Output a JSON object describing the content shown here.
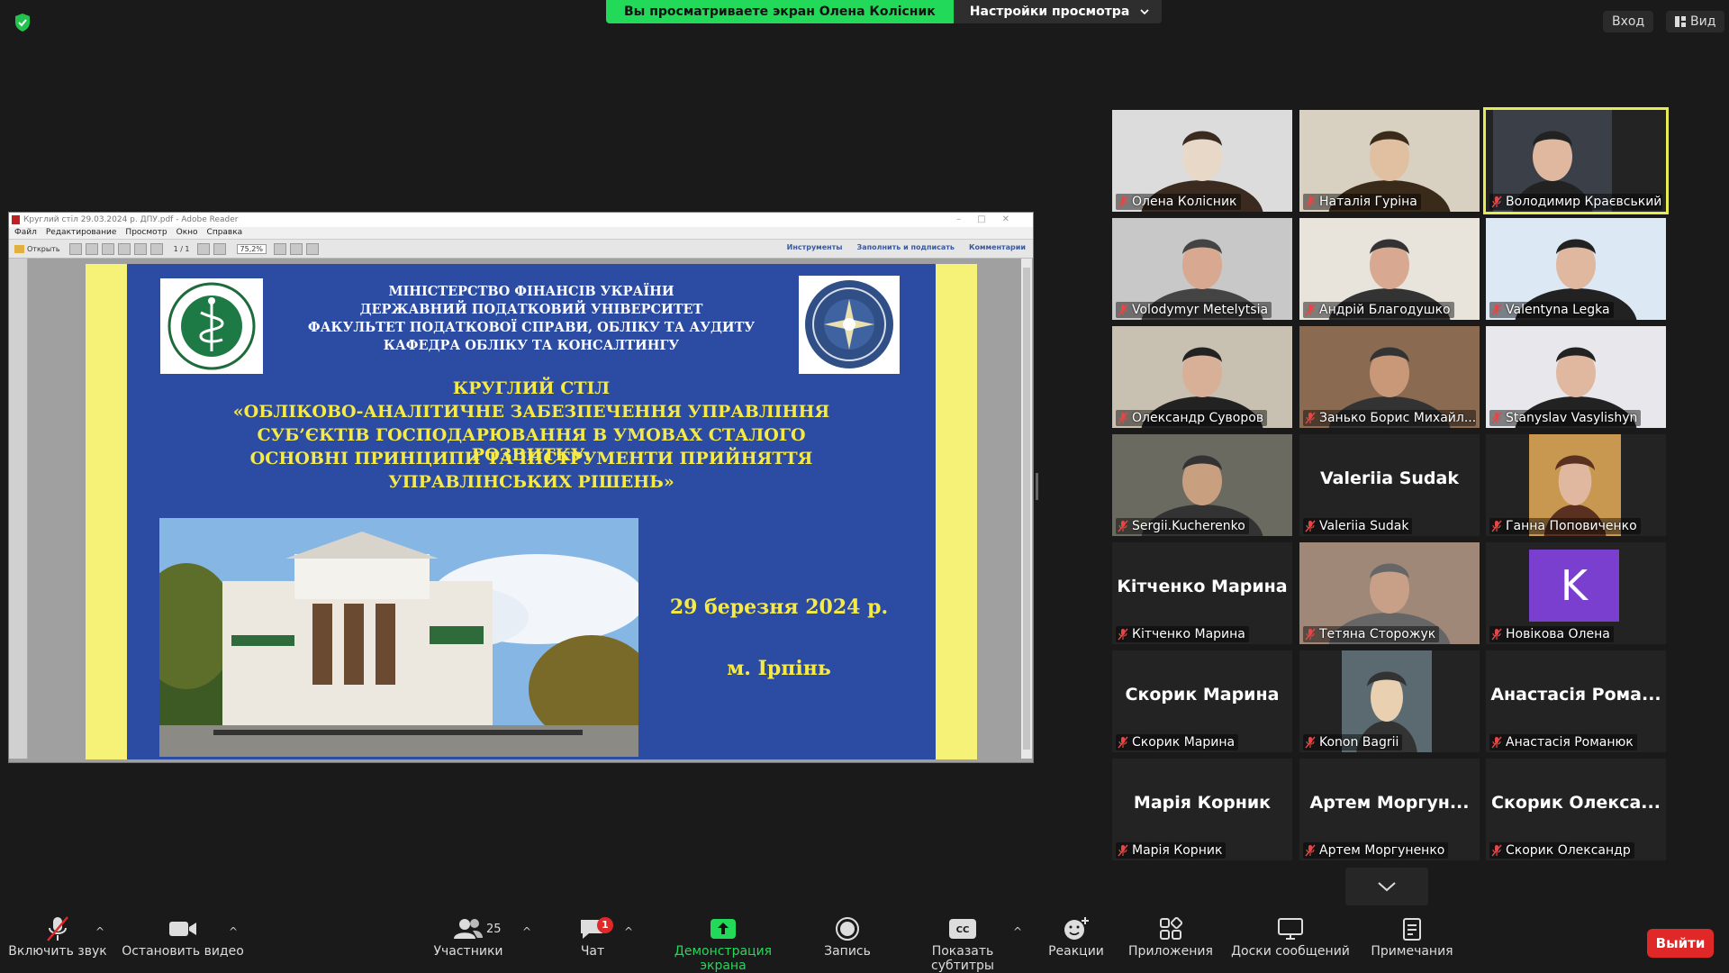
{
  "banner": {
    "sharing_text": "Вы просматриваете экран Олена Колісник",
    "view_settings": "Настройки просмотра"
  },
  "top_right": {
    "login": "Вход",
    "view": "Вид"
  },
  "reader": {
    "title": "Круглий стіл 29.03.2024 р. ДПУ.pdf - Adobe Reader",
    "menu": [
      "Файл",
      "Редактирование",
      "Просмотр",
      "Окно",
      "Справка"
    ],
    "open_label": "Открыть",
    "page_label": "1 / 1",
    "zoom": "75,2%",
    "tools": "Инструменты",
    "fill_sign": "Заполнить и подписать",
    "comments": "Комментарии"
  },
  "slide": {
    "org_lines": [
      "МІНІСТЕРСТВО ФІНАНСІВ УКРАЇНИ",
      "ДЕРЖАВНИЙ ПОДАТКОВИЙ УНІВЕРСИТЕТ",
      "ФАКУЛЬТЕТ ПОДАТКОВОЇ СПРАВИ, ОБЛІКУ ТА АУДИТУ",
      "КАФЕДРА ОБЛІКУ ТА КОНСАЛТИНГУ"
    ],
    "title_lines": [
      "КРУГЛИЙ СТІЛ",
      "«ОБЛІКОВО-АНАЛІТИЧНЕ ЗАБЕЗПЕЧЕННЯ УПРАВЛІННЯ",
      "СУБ’ЄКТІВ ГОСПОДАРЮВАННЯ В УМОВАХ СТАЛОГО РОЗВИТКУ:",
      "ОСНОВНІ ПРИНЦИПИ ТА ІНСТРУМЕНТИ ПРИЙНЯТТЯ",
      "УПРАВЛІНСЬКИХ РІШЕНЬ»"
    ],
    "date": "29 березня 2024 р.",
    "city": "м. Ірпінь"
  },
  "participants": [
    {
      "name": "Олена Колісник",
      "big": ""
    },
    {
      "name": "Наталія Гуріна",
      "big": ""
    },
    {
      "name": "Володимир Краєвський",
      "big": ""
    },
    {
      "name": "Volodymyr Metelytsia",
      "big": ""
    },
    {
      "name": "Андрій Благодушко",
      "big": ""
    },
    {
      "name": "Valentyna Legka",
      "big": ""
    },
    {
      "name": "Олександр Суворов",
      "big": ""
    },
    {
      "name": "Занько Борис Михайл...",
      "big": ""
    },
    {
      "name": "Stanyslav Vasylishyn",
      "big": ""
    },
    {
      "name": "Sergii.Kucherenko",
      "big": ""
    },
    {
      "name": "Valeriia Sudak",
      "big": "Valeriia Sudak"
    },
    {
      "name": "Ганна Поповиченко",
      "big": ""
    },
    {
      "name": "Кітченко Марина",
      "big": "Кітченко Марина"
    },
    {
      "name": "Тетяна Сторожук",
      "big": ""
    },
    {
      "name": "Новікова Олена",
      "big": ""
    },
    {
      "name": "Скорик Марина",
      "big": "Скорик Марина"
    },
    {
      "name": "Konon Bagrii",
      "big": ""
    },
    {
      "name": "Анастасія Романюк",
      "big": "Анастасія Рома..."
    },
    {
      "name": "Марія Корник",
      "big": "Марія Корник"
    },
    {
      "name": "Артем Моргуненко",
      "big": "Артем Моргун..."
    },
    {
      "name": "Скорик Олександр",
      "big": "Скорик Олекса..."
    }
  ],
  "avatar_letter": "K",
  "toolbar": {
    "unmute": "Включить звук",
    "stop_video": "Остановить видео",
    "participants": "Участники",
    "participants_count": "25",
    "chat": "Чат",
    "chat_badge": "1",
    "share": "Демонстрация экрана",
    "record": "Запись",
    "captions": "Показать субтитры",
    "reactions": "Реакции",
    "apps": "Приложения",
    "whiteboards": "Доски сообщений",
    "notes": "Примечания",
    "leave": "Выйти"
  },
  "colors": {
    "share_green": "#23d959",
    "active_speaker": "#e6ea55",
    "leave_red": "#e02828",
    "slide_blue": "#2c4ca4",
    "slide_yellow": "#f5ea48"
  }
}
